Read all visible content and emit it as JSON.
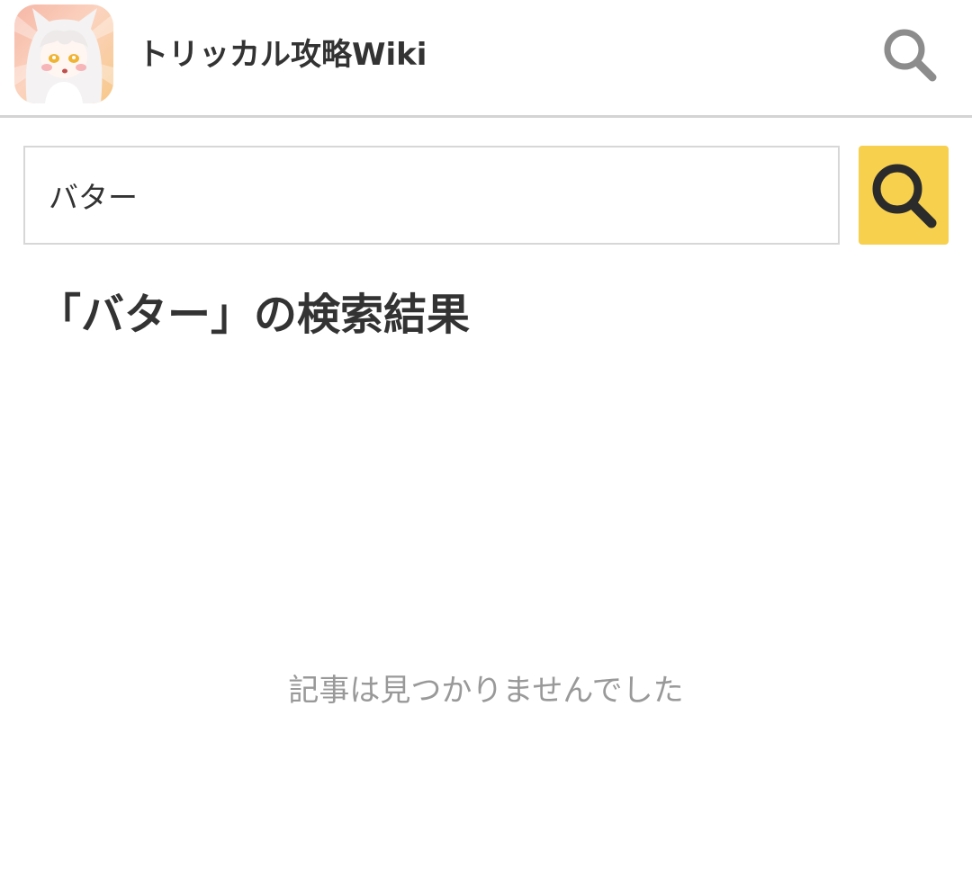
{
  "header": {
    "site_title": "トリッカル攻略Wiki",
    "logo_icon": "character-avatar-icon",
    "search_icon": "search-icon"
  },
  "search": {
    "value": "バター",
    "button_icon": "search-icon",
    "button_color": "#f7d04e"
  },
  "results": {
    "heading": "「バター」の検索結果",
    "empty_message": "記事は見つかりませんでした"
  },
  "colors": {
    "text": "#333333",
    "muted": "#999999",
    "border": "#d7d7d7",
    "accent": "#f7d04e"
  }
}
